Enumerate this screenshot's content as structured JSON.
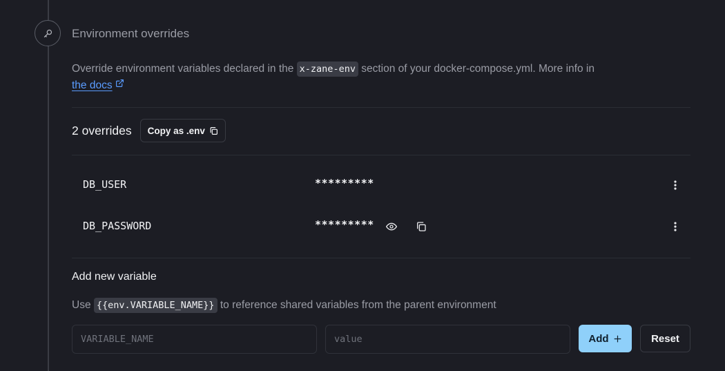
{
  "section": {
    "title": "Environment overrides",
    "description_before": "Override environment variables declared in the ",
    "description_code": "x-zane-env",
    "description_after": " section of your docker-compose.yml. More info in ",
    "docs_link": "the docs"
  },
  "overrides": {
    "count_label": "2 overrides",
    "copy_button": "Copy as .env",
    "items": [
      {
        "name": "DB_USER",
        "value": "*********"
      },
      {
        "name": "DB_PASSWORD",
        "value": "*********"
      }
    ]
  },
  "add_variable": {
    "title": "Add new variable",
    "hint_before": "Use ",
    "hint_code": "{{env.VARIABLE_NAME}}",
    "hint_after": " to reference shared variables from the parent environment",
    "name_placeholder": "VARIABLE_NAME",
    "value_placeholder": "value",
    "add_button": "Add",
    "reset_button": "Reset"
  },
  "icons": {
    "section": "key-icon",
    "external_link": "external-link-icon",
    "copy": "copy-icon",
    "reveal": "eye-icon",
    "menu": "more-vertical-icon",
    "add": "plus-icon"
  },
  "colors": {
    "background": "#1c1d24",
    "accent": "#8fd0fa",
    "link": "#5a9cff"
  }
}
